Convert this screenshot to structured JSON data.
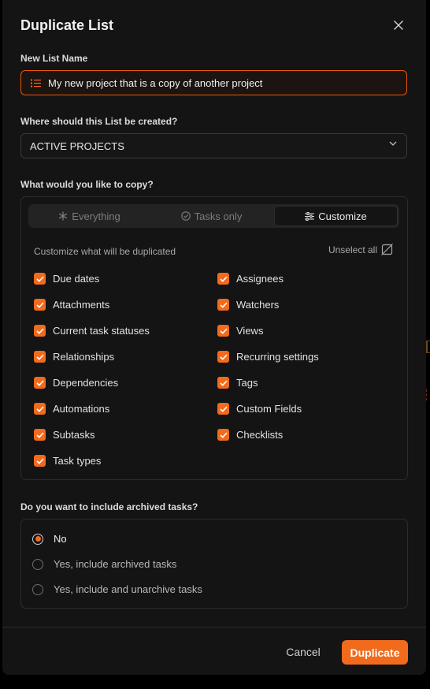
{
  "dialog": {
    "title": "Duplicate List"
  },
  "name_field": {
    "label": "New List Name",
    "value": "My new project that is a copy of another project"
  },
  "location": {
    "label": "Where should this List be created?",
    "selected": "ACTIVE PROJECTS"
  },
  "copy": {
    "label": "What would you like to copy?",
    "tabs": [
      {
        "label": "Everything",
        "icon": "asterisk-icon",
        "active": false
      },
      {
        "label": "Tasks only",
        "icon": "check-circle-icon",
        "active": false
      },
      {
        "label": "Customize",
        "icon": "sliders-icon",
        "active": true
      }
    ],
    "customize_label": "Customize what will be duplicated",
    "unselect_all": "Unselect all",
    "left_options": [
      {
        "label": "Due dates",
        "checked": true
      },
      {
        "label": "Attachments",
        "checked": true
      },
      {
        "label": "Current task statuses",
        "checked": true
      },
      {
        "label": "Relationships",
        "checked": true
      },
      {
        "label": "Dependencies",
        "checked": true
      },
      {
        "label": "Automations",
        "checked": true
      },
      {
        "label": "Subtasks",
        "checked": true
      },
      {
        "label": "Task types",
        "checked": true
      }
    ],
    "right_options": [
      {
        "label": "Assignees",
        "checked": true
      },
      {
        "label": "Watchers",
        "checked": true
      },
      {
        "label": "Views",
        "checked": true
      },
      {
        "label": "Recurring settings",
        "checked": true
      },
      {
        "label": "Tags",
        "checked": true
      },
      {
        "label": "Custom Fields",
        "checked": true
      },
      {
        "label": "Checklists",
        "checked": true
      }
    ]
  },
  "archived": {
    "label": "Do you want to include archived tasks?",
    "options": [
      {
        "label": "No",
        "selected": true
      },
      {
        "label": "Yes, include archived tasks",
        "selected": false
      },
      {
        "label": "Yes, include and unarchive tasks",
        "selected": false
      }
    ]
  },
  "footer": {
    "cancel": "Cancel",
    "duplicate": "Duplicate"
  },
  "colors": {
    "accent": "#f26b1d",
    "background": "#141414"
  }
}
